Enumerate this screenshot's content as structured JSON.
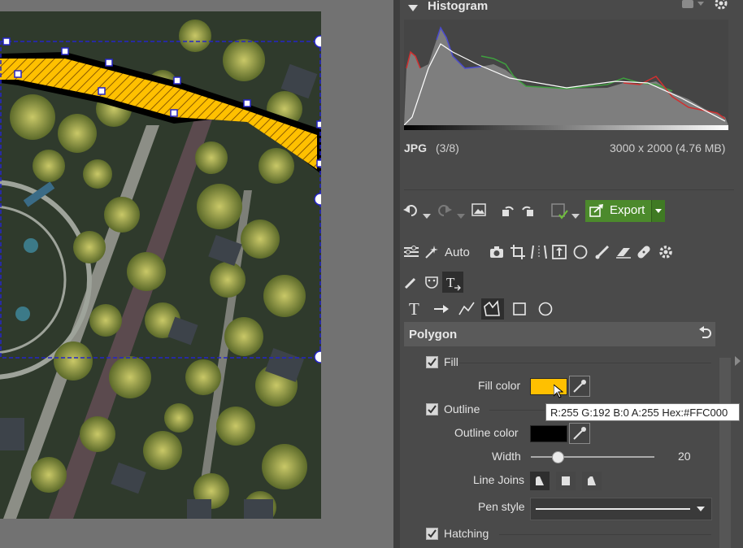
{
  "histogram": {
    "title": "Histogram",
    "format": "JPG",
    "position": "(3/8)",
    "dimensions": "3000 x 2000 (4.76 MB)"
  },
  "toolbar": {
    "export_label": "Export",
    "auto_label": "Auto"
  },
  "polygon": {
    "title": "Polygon",
    "fill_label": "Fill",
    "fill_color_label": "Fill color",
    "fill_color": "#FFC000",
    "outline_label": "Outline",
    "outline_color_label": "Outline color",
    "outline_color": "#000000",
    "width_label": "Width",
    "width_value": "20",
    "width_fraction": 0.22,
    "line_joins_label": "Line Joins",
    "pen_style_label": "Pen style",
    "hatching_label": "Hatching"
  },
  "tooltip": {
    "text": "R:255 G:192 B:0 A:255 Hex:#FFC000"
  },
  "colors": {
    "accent_green": "#4c8a2c",
    "panel_bg": "#4a4a4a",
    "polygon_fill": "#FFC000"
  }
}
